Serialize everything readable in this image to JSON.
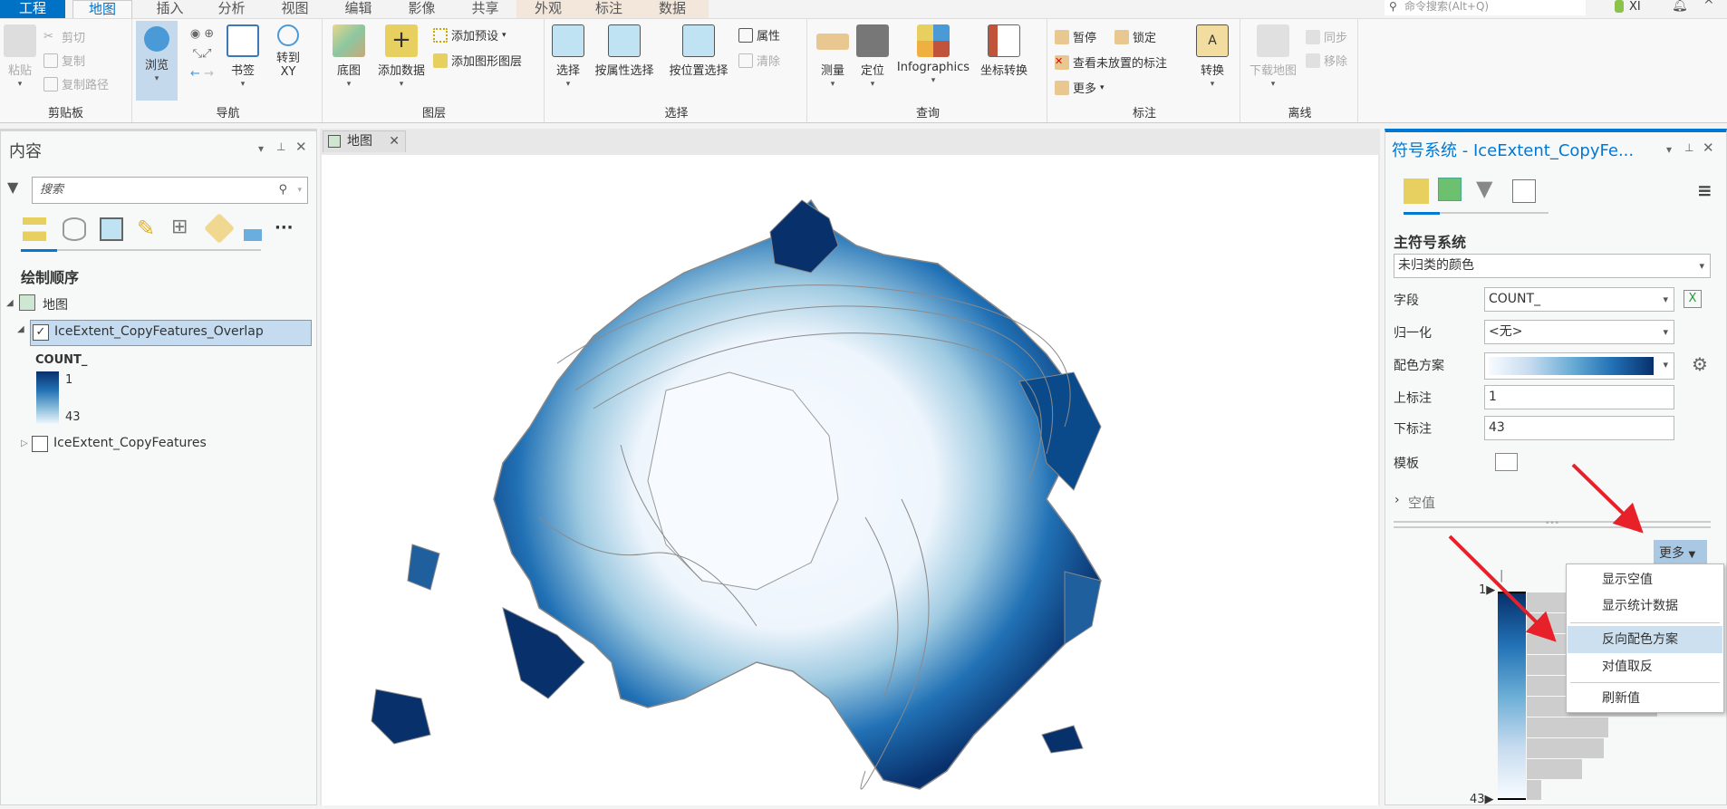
{
  "tabs": [
    {
      "label": "工程"
    },
    {
      "label": "地图"
    },
    {
      "label": "插入"
    },
    {
      "label": "分析"
    },
    {
      "label": "视图"
    },
    {
      "label": "编辑"
    },
    {
      "label": "影像"
    },
    {
      "label": "共享"
    },
    {
      "label": "外观"
    },
    {
      "label": "标注"
    },
    {
      "label": "数据"
    }
  ],
  "command_search": {
    "placeholder": "命令搜索(Alt+Q)"
  },
  "user": {
    "name": "XI"
  },
  "ribbon": {
    "clipboard": {
      "label": "剪贴板",
      "paste": "粘贴",
      "cut": "剪切",
      "copy": "复制",
      "copy_path": "复制路径"
    },
    "navigate": {
      "label": "导航",
      "explore": "浏览",
      "bookmarks": "书签",
      "goto_xy": "转到\nXY"
    },
    "layer": {
      "label": "图层",
      "basemap": "底图",
      "add_data": "添加数据",
      "add_preset": "添加预设",
      "add_graphics": "添加图形图层"
    },
    "selection": {
      "label": "选择",
      "select": "选择",
      "by_attr": "按属性选择",
      "by_loc": "按位置选择",
      "attributes": "属性",
      "clear": "清除"
    },
    "inquiry": {
      "label": "查询",
      "measure": "测量",
      "locate": "定位",
      "infographics": "Infographics",
      "convert_coord": "坐标转换"
    },
    "labeling": {
      "label": "标注",
      "pause": "暂停",
      "lock": "锁定",
      "unplaced": "查看未放置的标注",
      "more": "更多",
      "convert": "转换"
    },
    "offline": {
      "label": "离线",
      "download": "下载地图",
      "sync": "同步",
      "remove": "移除"
    }
  },
  "contents": {
    "title": "内容",
    "search_placeholder": "搜索",
    "draw_order": "绘制顺序",
    "map_name": "地图",
    "layers": [
      {
        "name": "IceExtent_CopyFeatures_Overlap",
        "checked": true,
        "selected": true
      },
      {
        "name": "IceExtent_CopyFeatures",
        "checked": false
      }
    ],
    "legend": {
      "field": "COUNT_",
      "high": "1",
      "low": "43"
    }
  },
  "map_tab": {
    "label": "地图"
  },
  "symbology": {
    "title": "符号系统 - IceExtent_CopyFe...",
    "section": "主符号系统",
    "method": "未归类的颜色",
    "field_label": "字段",
    "field_value": "COUNT_",
    "norm_label": "归一化",
    "norm_value": "<无>",
    "ramp_label": "配色方案",
    "upper_label": "上标注",
    "upper_value": "1",
    "lower_label": "下标注",
    "lower_value": "43",
    "template_label": "模板",
    "null_label": "空值",
    "more_button": "更多",
    "ramp_colors": [
      "#f7fbff",
      "#c6dbef",
      "#6baed6",
      "#2171b5",
      "#08306b"
    ],
    "histogram": {
      "top_label": "1",
      "bottom_label": "43",
      "bar_values": [
        100,
        95,
        92,
        90,
        88,
        80,
        50,
        47,
        34,
        9
      ]
    },
    "menu": [
      {
        "label": "显示空值"
      },
      {
        "label": "显示统计数据"
      },
      {
        "label": "反向配色方案",
        "highlighted": true
      },
      {
        "label": "对值取反"
      },
      {
        "label": "刷新值"
      }
    ]
  },
  "colors": {
    "accent": "#0078d4",
    "selected_tab_bg": "#0072c6",
    "map_dark": "#08306b",
    "arrow": "#e8202a"
  }
}
